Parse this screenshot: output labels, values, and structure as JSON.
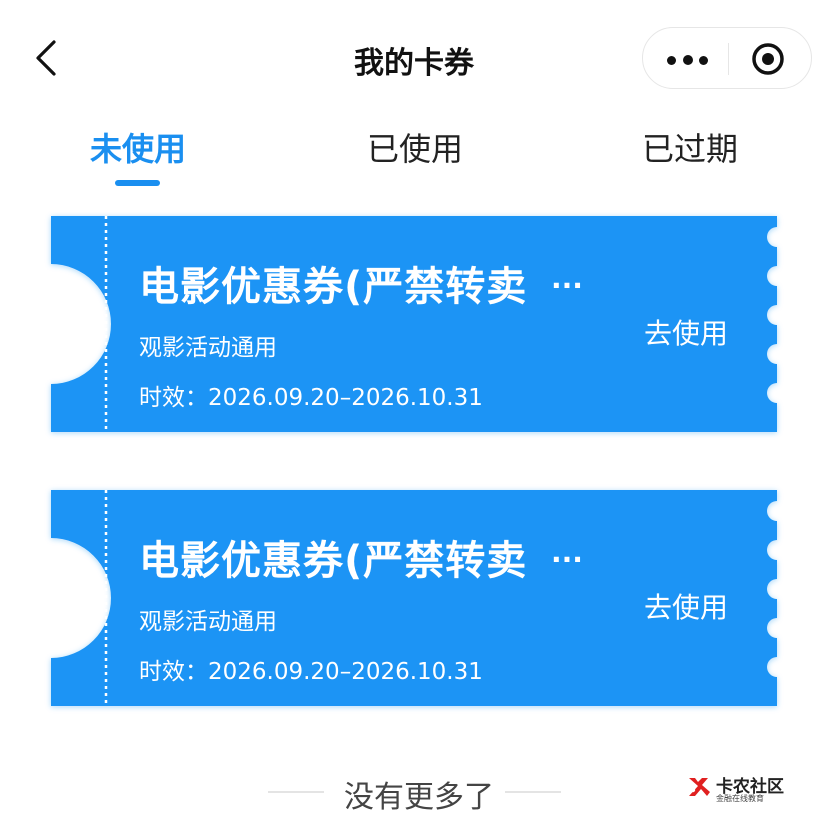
{
  "header": {
    "title": "我的卡券",
    "back_icon": "chevron-left-icon",
    "more_icon": "more-dots-icon",
    "close_icon": "target-icon"
  },
  "tabs": [
    {
      "label": "未使用",
      "active": true
    },
    {
      "label": "已使用",
      "active": false
    },
    {
      "label": "已过期",
      "active": false
    }
  ],
  "coupons": [
    {
      "title": "电影优惠券(严禁转卖",
      "ellipsis": "...",
      "subtitle": "观影活动通用",
      "validity_label": "时效：",
      "validity_range": "2026.09.20–2026.10.31",
      "action": "去使用"
    },
    {
      "title": "电影优惠券(严禁转卖",
      "ellipsis": "...",
      "subtitle": "观影活动通用",
      "validity_label": "时效：",
      "validity_range": "2026.09.20–2026.10.31",
      "action": "去使用"
    }
  ],
  "footer": {
    "end_text": "没有更多了"
  },
  "watermark": {
    "name": "卡农社区",
    "tagline": "金融在线教育"
  },
  "colors": {
    "accent": "#1a8ff0",
    "coupon": "#1a94f5"
  }
}
